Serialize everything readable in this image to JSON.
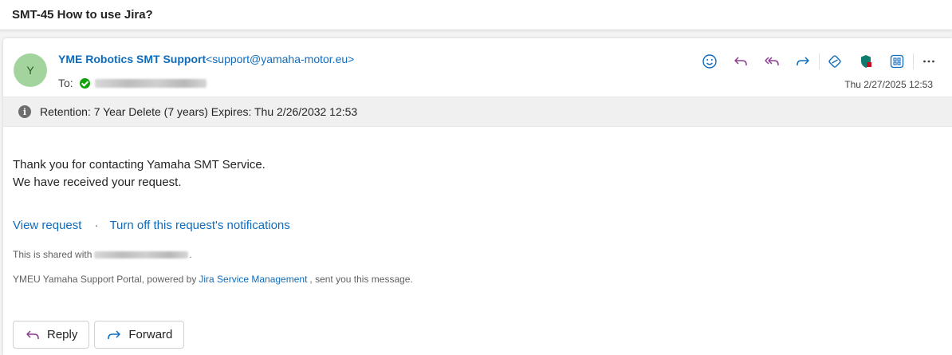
{
  "subject": "SMT-45 How to use Jira?",
  "sender": {
    "avatar_initial": "Y",
    "name": "YME Robotics SMT Support",
    "email": "<support@yamaha-motor.eu>",
    "to_label": "To:"
  },
  "toolbar": {
    "icons": [
      "emoji-icon",
      "reply-icon",
      "reply-all-icon",
      "forward-icon",
      "tag-icon",
      "shield-icon",
      "apps-icon",
      "more-icon"
    ],
    "accent_color": "#0f6cbd",
    "reply_color": "#8a3b8f"
  },
  "date": "Thu 2/27/2025 12:53",
  "retention": "Retention: 7 Year Delete (7 years) Expires: Thu 2/26/2032 12:53",
  "body": {
    "line1": "Thank you for contacting Yamaha SMT Service.",
    "line2": "We have received your request."
  },
  "links": {
    "view_request": "View request",
    "separator": "·",
    "turn_off": "Turn off this request's notifications"
  },
  "shared": {
    "prefix": "This is shared with",
    "suffix": "."
  },
  "footer": {
    "prefix": "YMEU Yamaha Support Portal, powered by",
    "link": "Jira Service Management",
    "suffix": ", sent you this message."
  },
  "actions": {
    "reply": "Reply",
    "forward": "Forward"
  }
}
